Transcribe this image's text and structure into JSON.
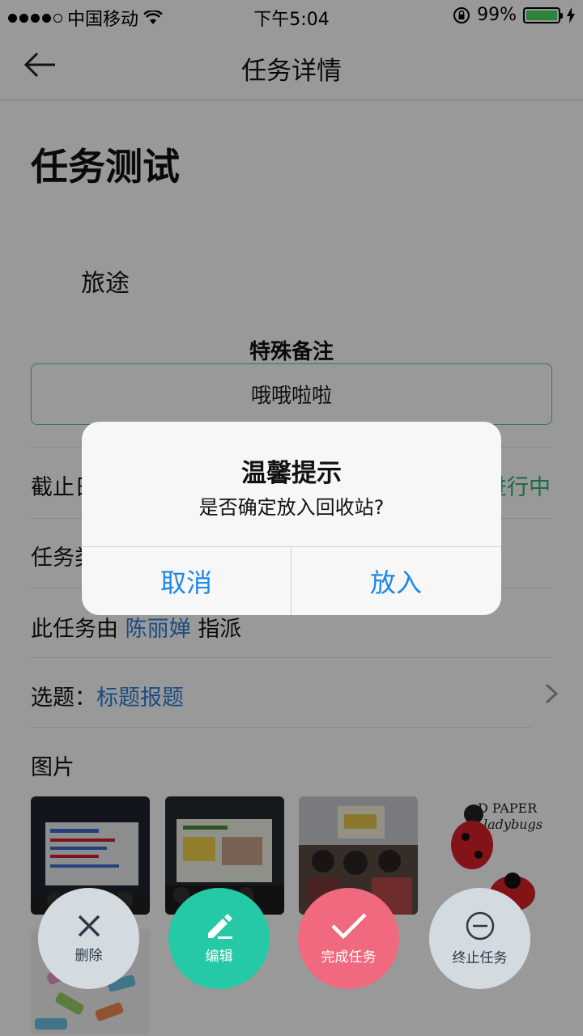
{
  "status_bar": {
    "carrier": "中国移动",
    "time": "下午5:04",
    "battery": "99%"
  },
  "nav": {
    "title": "任务详情"
  },
  "task": {
    "title": "任务测试",
    "trip": "旅途",
    "note_label": "特殊备注",
    "note_text": "哦哦啦啦",
    "deadline_label": "截止日",
    "status": "进行中",
    "type_label": "任务类",
    "assigned_prefix": "此任务由",
    "assigned_name": "陈丽婵",
    "assigned_suffix": "指派",
    "topic_label": "选题：",
    "topic_value": "标题报题",
    "images_label": "图片"
  },
  "actions": {
    "delete": "删除",
    "edit": "编辑",
    "complete": "完成任务",
    "stop": "终止任务"
  },
  "dialog": {
    "title": "温馨提示",
    "message": "是否确定放入回收站?",
    "cancel": "取消",
    "confirm": "放入"
  }
}
